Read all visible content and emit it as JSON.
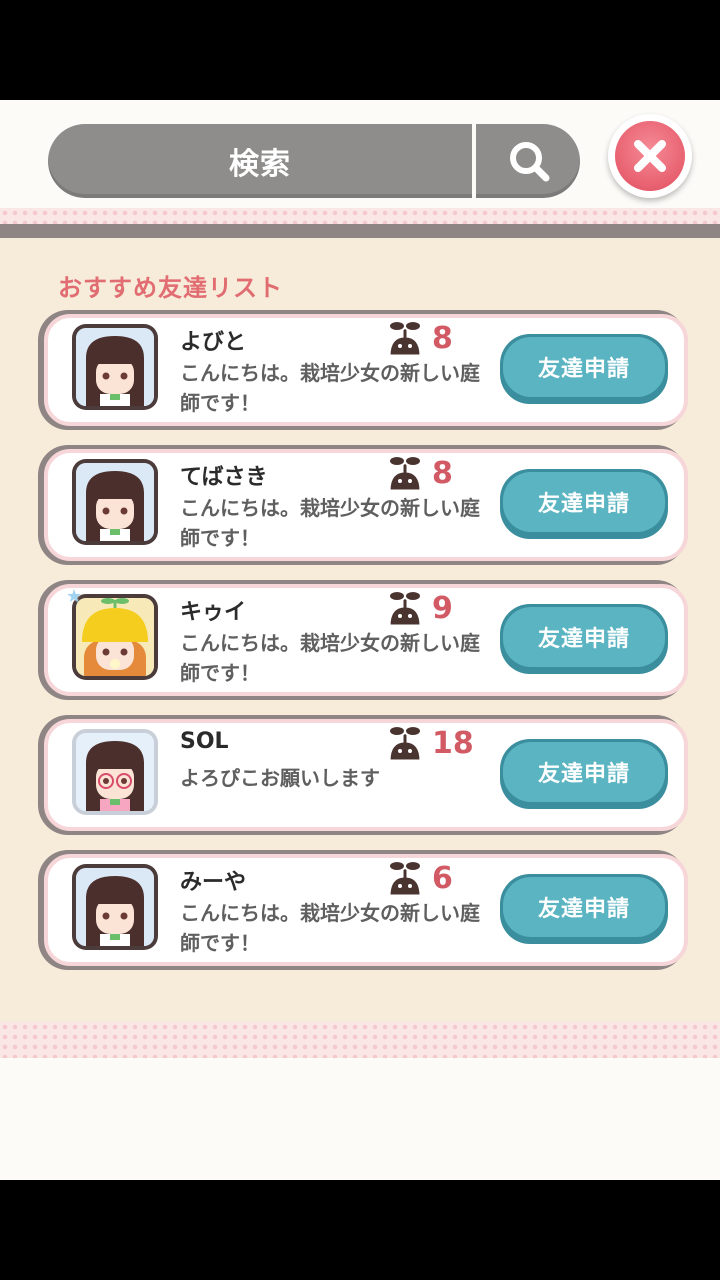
{
  "search": {
    "placeholder": "検索",
    "search_icon": "magnifier-icon",
    "close_icon": "close-x-icon"
  },
  "section": {
    "title": "おすすめ友達リスト"
  },
  "friends": [
    {
      "name": "よびと",
      "level": "8",
      "message": "こんにちは。栽培少女の新しい庭師です！",
      "button": "友達申請",
      "avatar_style": "dark-hair-girl"
    },
    {
      "name": "てばさき",
      "level": "8",
      "message": "こんにちは。栽培少女の新しい庭師です！",
      "button": "友達申請",
      "avatar_style": "dark-hair-girl"
    },
    {
      "name": "キゥイ",
      "level": "9",
      "message": "こんにちは。栽培少女の新しい庭師です！",
      "button": "友達申請",
      "avatar_style": "yellow-hat-girl"
    },
    {
      "name": "SOL",
      "level": "18",
      "message": "よろぴこお願いします",
      "button": "友達申請",
      "avatar_style": "glasses-girl"
    },
    {
      "name": "みーや",
      "level": "6",
      "message": "こんにちは。栽培少女の新しい庭師です！",
      "button": "友達申請",
      "avatar_style": "dark-hair-girl"
    }
  ],
  "colors": {
    "accent_pink": "#e16c71",
    "level_red": "#d25a64",
    "button_teal": "#5bb4c1",
    "panel_bg": "#f6ecd9"
  }
}
